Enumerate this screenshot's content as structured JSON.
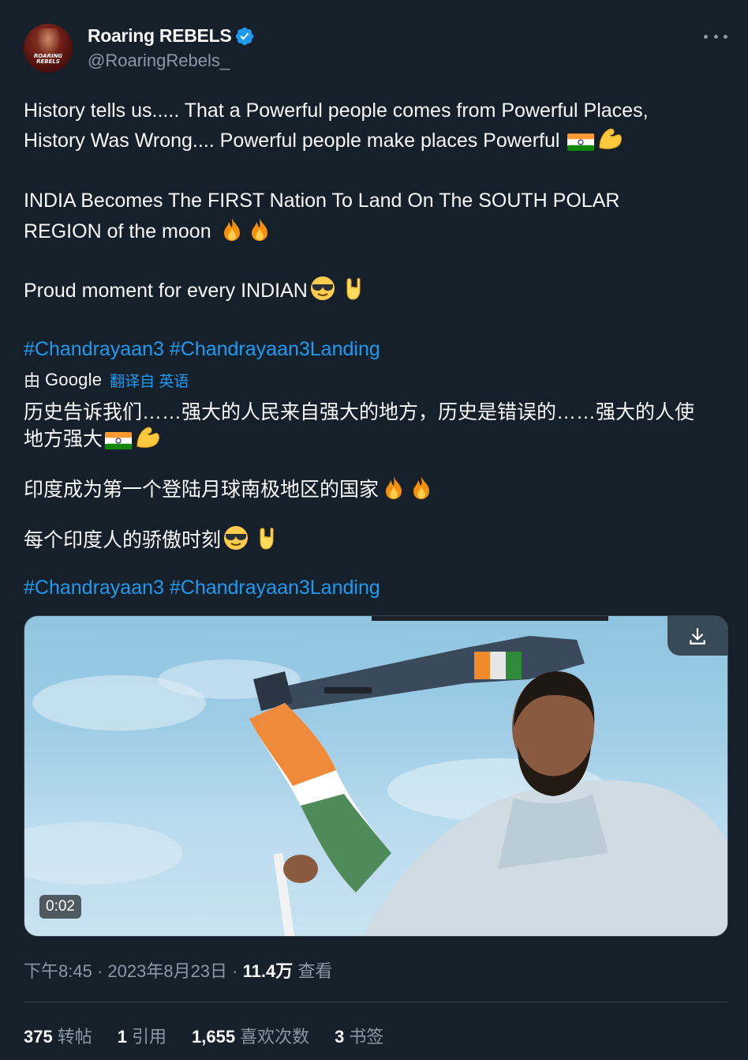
{
  "author": {
    "display_name": "Roaring REBELS",
    "handle": "@RoaringRebels_",
    "avatar_text": "ROARING REBELS",
    "verified_color": "#1d9bf0"
  },
  "tweet": {
    "lines": [
      "History tells us..... That a Powerful people comes from Powerful Places,",
      "History Was Wrong.... Powerful people make places Powerful ",
      "INDIA Becomes The FIRST Nation To Land On The SOUTH POLAR",
      "REGION of the moon ",
      "Proud moment for every INDIAN"
    ],
    "hashtags": "#Chandrayaan3 #Chandrayaan3Landing"
  },
  "translation": {
    "by_label": "由",
    "provider": "Google",
    "link_label": "翻译自 英语",
    "lines": [
      "历史告诉我们……强大的人民来自强大的地方，历史是错误的……强大的人使",
      "地方强大",
      "印度成为第一个登陆月球南极地区的国家",
      "每个印度人的骄傲时刻"
    ],
    "hashtags": "#Chandrayaan3 #Chandrayaan3Landing"
  },
  "media": {
    "duration": "0:02",
    "download_icon": "download-icon"
  },
  "meta": {
    "time": "下午8:45",
    "date": "2023年8月23日",
    "views_count": "11.4万",
    "views_label": "查看"
  },
  "stats": [
    {
      "count": "375",
      "label": "转帖"
    },
    {
      "count": "1",
      "label": "引用"
    },
    {
      "count": "1,655",
      "label": "喜欢次数"
    },
    {
      "count": "3",
      "label": "书签"
    }
  ],
  "colors": {
    "background": "#15202b",
    "text": "#f7f9f9",
    "secondary": "#8b98a5",
    "accent": "#1d9bf0"
  }
}
